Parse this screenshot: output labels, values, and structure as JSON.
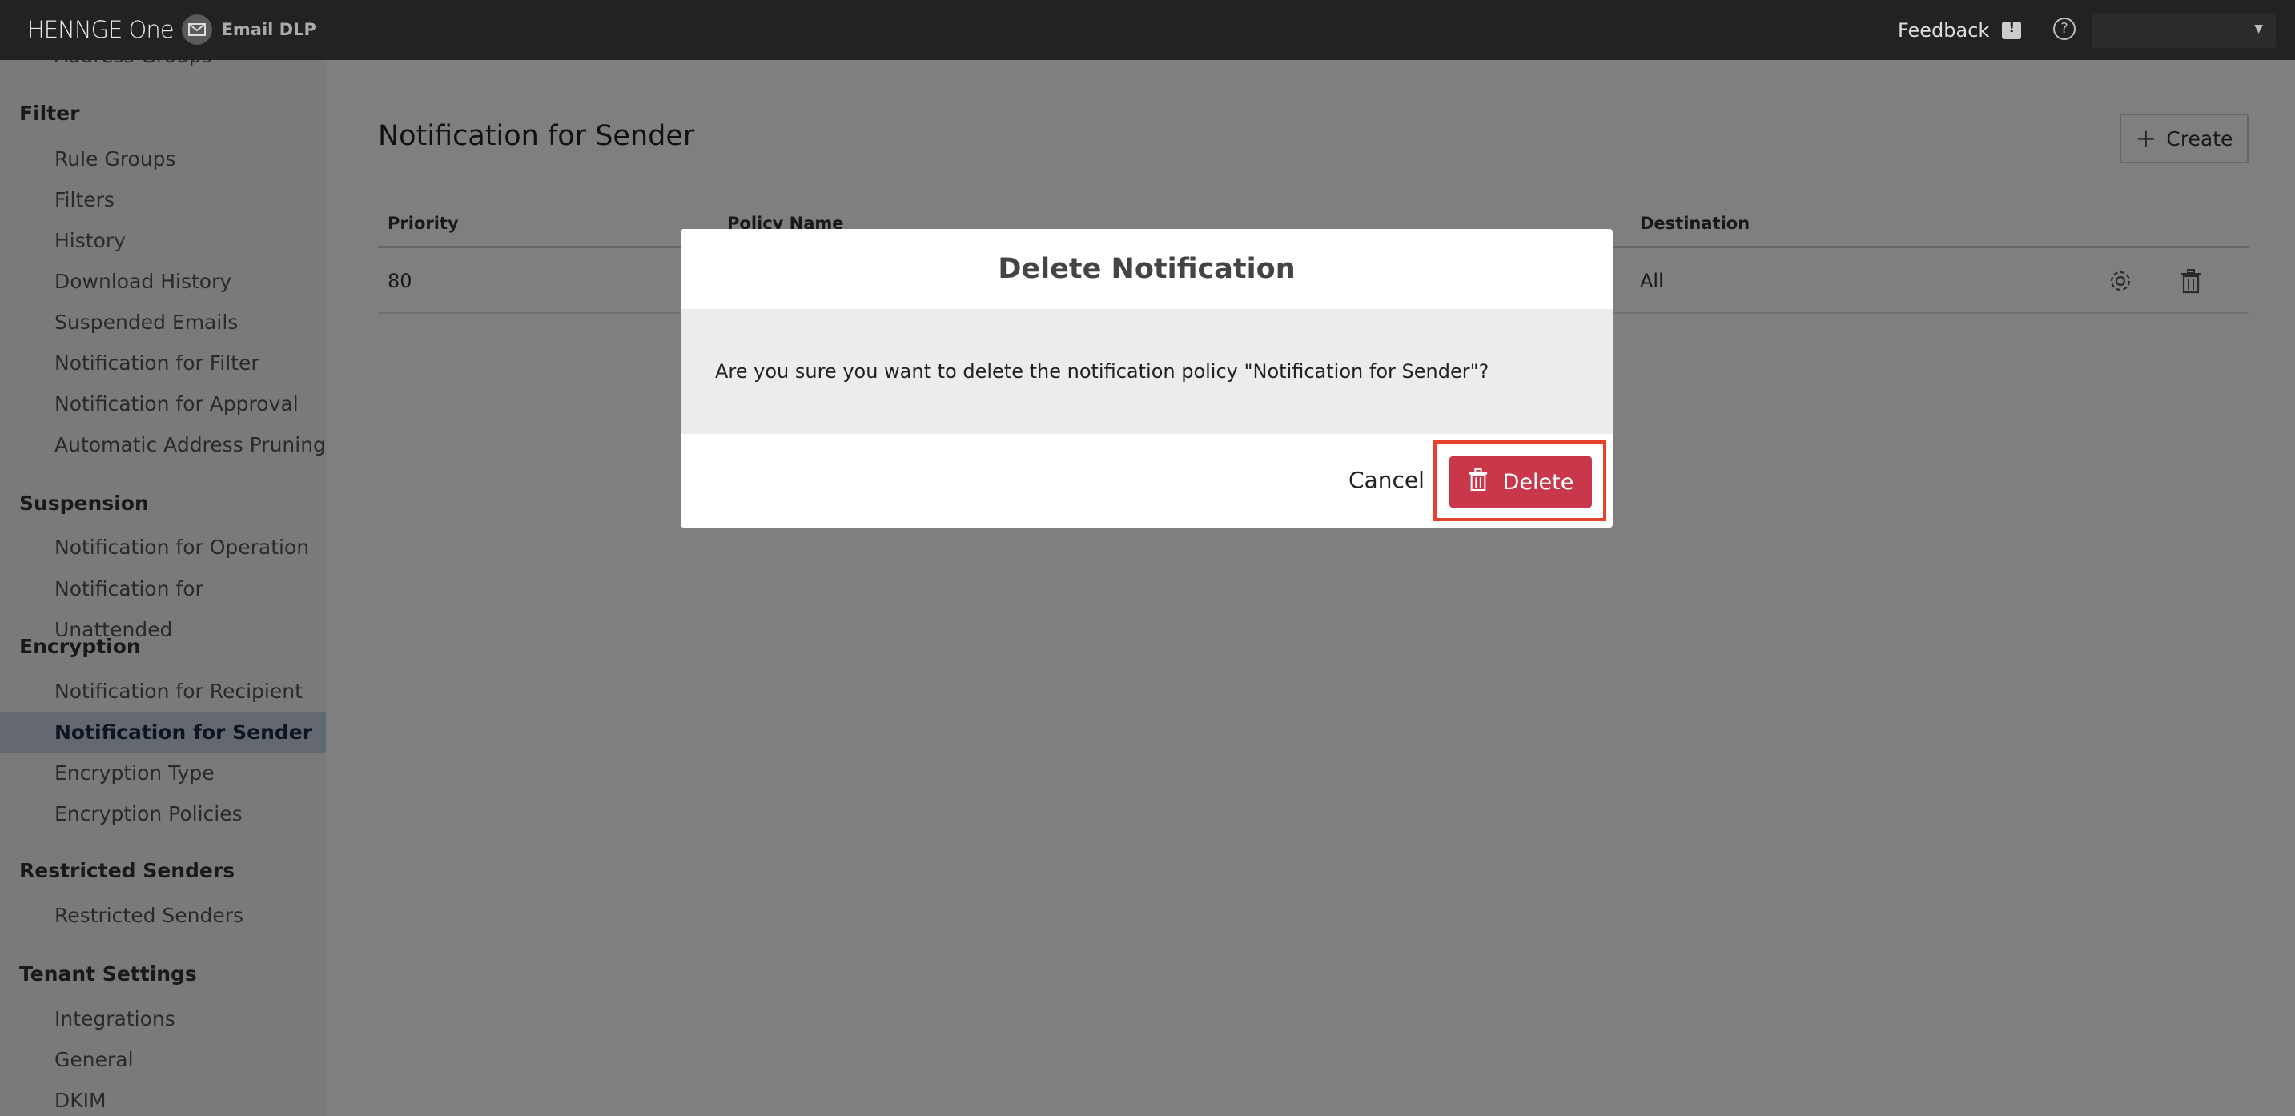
{
  "header": {
    "brand_name": "HENNGE One",
    "product": "Email DLP",
    "feedback_label": "Feedback",
    "user_label": ""
  },
  "sidebar": {
    "clipped_item": "Address Groups",
    "sections": [
      {
        "title": "Filter",
        "items": [
          "Rule Groups",
          "Filters",
          "History",
          "Download History",
          "Suspended Emails",
          "Notification for Filter",
          "Notification for Approval",
          "Automatic Address Pruning"
        ]
      },
      {
        "title": "Suspension",
        "items": [
          "Notification for Operation",
          "Notification for Unattended"
        ]
      },
      {
        "title": "Encryption",
        "items": [
          "Notification for Recipient",
          "Notification for Sender",
          "Encryption Type",
          "Encryption Policies"
        ]
      },
      {
        "title": "Restricted Senders",
        "items": [
          "Restricted Senders"
        ]
      },
      {
        "title": "Tenant Settings",
        "items": [
          "Integrations",
          "General",
          "DKIM"
        ]
      }
    ],
    "active_item": "Notification for Sender"
  },
  "main": {
    "title": "Notification for Sender",
    "create_label": "Create",
    "columns": [
      "Priority",
      "Policy Name",
      "Destination"
    ],
    "rows": [
      {
        "priority": "80",
        "policy_name": "",
        "destination": "All"
      }
    ]
  },
  "modal": {
    "title": "Delete Notification",
    "message": "Are you sure you want to delete the notification policy \"Notification for Sender\"?",
    "cancel_label": "Cancel",
    "delete_label": "Delete"
  },
  "colors": {
    "topbar": "#222222",
    "delete_button": "#c9374a",
    "highlight": "#e8412c",
    "active_item_bg": "#c6d0e2"
  }
}
